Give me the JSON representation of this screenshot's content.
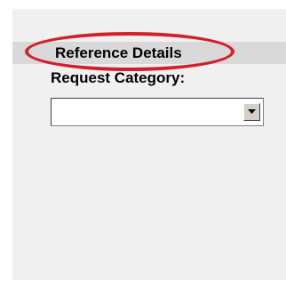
{
  "section": {
    "title": "Reference Details"
  },
  "request_category": {
    "label": "Request Category:",
    "selected_value": "",
    "icon": "chevron-down-icon"
  },
  "colors": {
    "panel_background": "#f0f0f0",
    "header_background": "#d9d9d9",
    "highlight": "#d2202a"
  }
}
